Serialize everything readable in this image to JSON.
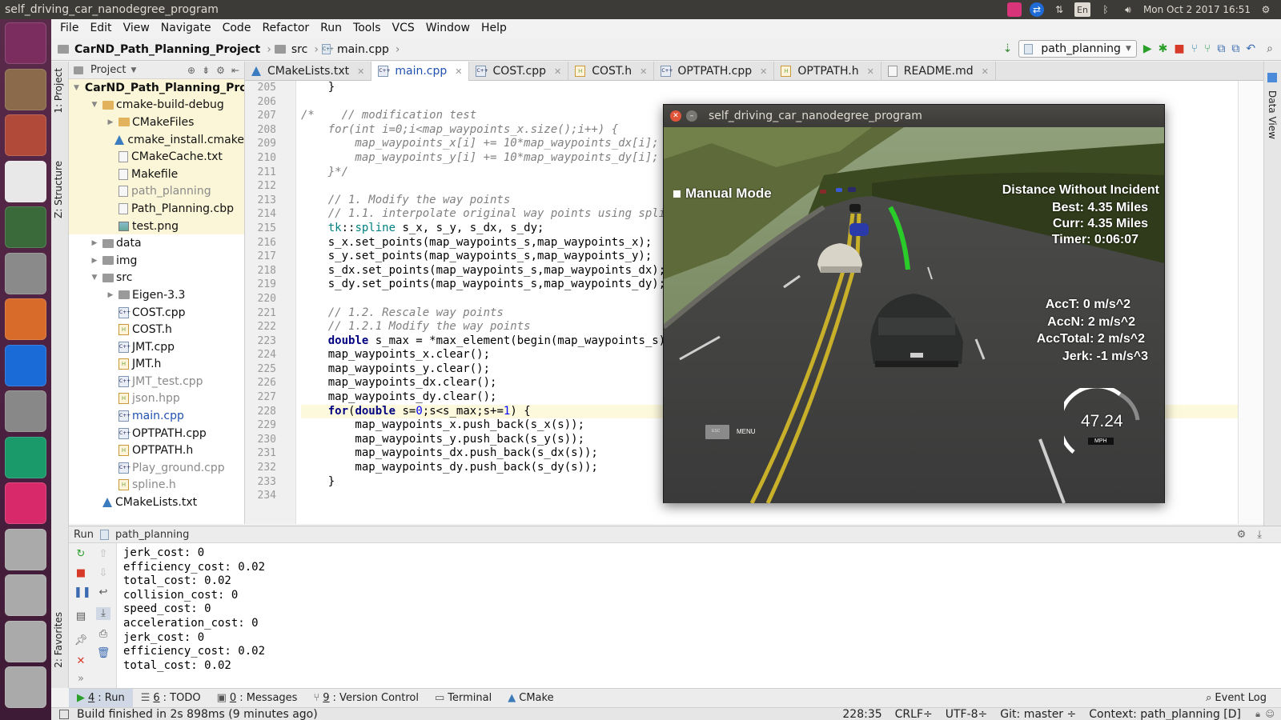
{
  "top_panel": {
    "title": "self_driving_car_nanodegree_program",
    "keyboard_layout": "En",
    "clock": "Mon Oct  2 2017 16:51"
  },
  "launcher": {
    "items": [
      {
        "icon": "ubuntu-dash-icon",
        "color": "#7b2d5f"
      },
      {
        "icon": "files-icon",
        "color": "#8a6a4a"
      },
      {
        "icon": "system-settings-icon",
        "color": "#b24a3a"
      },
      {
        "icon": "chrome-icon",
        "color": "#e8e8e8"
      },
      {
        "icon": "terminal-download-icon",
        "color": "#3a6a3a"
      },
      {
        "icon": "camera-icon",
        "color": "#8a8a8a"
      },
      {
        "icon": "software-center-icon",
        "color": "#d86a2a"
      },
      {
        "icon": "teamviewer-icon",
        "color": "#1a6ad8"
      },
      {
        "icon": "help-icon",
        "color": "#888888"
      },
      {
        "icon": "clion-icon",
        "color": "#1a9a6a"
      },
      {
        "icon": "jetbrains-toolbox-icon",
        "color": "#d82a6a"
      },
      {
        "icon": "drive-icon",
        "color": "#aaaaaa"
      },
      {
        "icon": "drive-icon",
        "color": "#aaaaaa"
      },
      {
        "icon": "drive-icon",
        "color": "#aaaaaa"
      },
      {
        "icon": "drive-icon",
        "color": "#aaaaaa"
      }
    ]
  },
  "menubar": [
    "File",
    "Edit",
    "View",
    "Navigate",
    "Code",
    "Refactor",
    "Run",
    "Tools",
    "VCS",
    "Window",
    "Help"
  ],
  "breadcrumb": {
    "project": "CarND_Path_Planning_Project",
    "folder": "src",
    "file": "main.cpp"
  },
  "run_config": "path_planning",
  "left_strip": {
    "project_tab": "1: Project",
    "structure_tab": "Z: Structure",
    "favorites_tab": "2: Favorites"
  },
  "right_strip": {
    "data_view_tab": "Data View"
  },
  "project_panel": {
    "header": "Project",
    "tree": [
      {
        "label": "CarND_Path_Planning_Pro",
        "indent": 0,
        "arrow": "down",
        "icon": "folder",
        "bold": true,
        "hl": true
      },
      {
        "label": "cmake-build-debug",
        "indent": 1,
        "arrow": "down",
        "icon": "folder-y",
        "hl": true
      },
      {
        "label": "CMakeFiles",
        "indent": 2,
        "arrow": "right",
        "icon": "folder-y",
        "hl": true
      },
      {
        "label": "cmake_install.cmake",
        "indent": 2,
        "arrow": "",
        "icon": "cmake",
        "hl": true
      },
      {
        "label": "CMakeCache.txt",
        "indent": 2,
        "arrow": "",
        "icon": "doc",
        "hl": true
      },
      {
        "label": "Makefile",
        "indent": 2,
        "arrow": "",
        "icon": "doc",
        "hl": true
      },
      {
        "label": "path_planning",
        "indent": 2,
        "arrow": "",
        "icon": "doc",
        "hl": true,
        "muted": true
      },
      {
        "label": "Path_Planning.cbp",
        "indent": 2,
        "arrow": "",
        "icon": "doc",
        "hl": true
      },
      {
        "label": "test.png",
        "indent": 2,
        "arrow": "",
        "icon": "img",
        "hl": true
      },
      {
        "label": "data",
        "indent": 1,
        "arrow": "right",
        "icon": "folder"
      },
      {
        "label": "img",
        "indent": 1,
        "arrow": "right",
        "icon": "folder"
      },
      {
        "label": "src",
        "indent": 1,
        "arrow": "down",
        "icon": "folder"
      },
      {
        "label": "Eigen-3.3",
        "indent": 2,
        "arrow": "right",
        "icon": "folder"
      },
      {
        "label": "COST.cpp",
        "indent": 2,
        "arrow": "",
        "icon": "cpp"
      },
      {
        "label": "COST.h",
        "indent": 2,
        "arrow": "",
        "icon": "h"
      },
      {
        "label": "JMT.cpp",
        "indent": 2,
        "arrow": "",
        "icon": "cpp"
      },
      {
        "label": "JMT.h",
        "indent": 2,
        "arrow": "",
        "icon": "h"
      },
      {
        "label": "JMT_test.cpp",
        "indent": 2,
        "arrow": "",
        "icon": "cpp",
        "muted": true
      },
      {
        "label": "json.hpp",
        "indent": 2,
        "arrow": "",
        "icon": "h",
        "muted": true
      },
      {
        "label": "main.cpp",
        "indent": 2,
        "arrow": "",
        "icon": "cpp",
        "active": true
      },
      {
        "label": "OPTPATH.cpp",
        "indent": 2,
        "arrow": "",
        "icon": "cpp"
      },
      {
        "label": "OPTPATH.h",
        "indent": 2,
        "arrow": "",
        "icon": "h"
      },
      {
        "label": "Play_ground.cpp",
        "indent": 2,
        "arrow": "",
        "icon": "cpp",
        "muted": true
      },
      {
        "label": "spline.h",
        "indent": 2,
        "arrow": "",
        "icon": "h",
        "muted": true
      },
      {
        "label": "CMakeLists.txt",
        "indent": 1,
        "arrow": "",
        "icon": "cmake"
      }
    ]
  },
  "editor_tabs": [
    {
      "label": "CMakeLists.txt",
      "icon": "cmake"
    },
    {
      "label": "main.cpp",
      "icon": "cpp",
      "active": true
    },
    {
      "label": "COST.cpp",
      "icon": "cpp"
    },
    {
      "label": "COST.h",
      "icon": "h"
    },
    {
      "label": "OPTPATH.cpp",
      "icon": "cpp"
    },
    {
      "label": "OPTPATH.h",
      "icon": "h"
    },
    {
      "label": "README.md",
      "icon": "md"
    }
  ],
  "editor": {
    "lines": [
      {
        "n": "205",
        "html": "    }"
      },
      {
        "n": "206",
        "html": ""
      },
      {
        "n": "207",
        "html": "<span class='cm'>/*    // modification test</span>"
      },
      {
        "n": "208",
        "html": "<span class='cm'>    for(int i=0;i&lt;map_waypoints_x.size();i++) {</span>"
      },
      {
        "n": "209",
        "html": "<span class='cm'>        map_waypoints_x[i] += 10*map_waypoints_dx[i];</span>"
      },
      {
        "n": "210",
        "html": "<span class='cm'>        map_waypoints_y[i] += 10*map_waypoints_dy[i];</span>"
      },
      {
        "n": "211",
        "html": "<span class='cm'>    }*/</span>"
      },
      {
        "n": "212",
        "html": ""
      },
      {
        "n": "213",
        "html": "<span class='cm'>    // 1. Modify the way points</span>"
      },
      {
        "n": "214",
        "html": "<span class='cm'>    // 1.1. interpolate original way points using spline</span>"
      },
      {
        "n": "215",
        "html": "    <span class='ns'>tk</span>::<span class='ns'>spline</span> s_x, s_y, s_dx, s_dy;"
      },
      {
        "n": "216",
        "html": "    s_x.set_points(map_waypoints_s,map_waypoints_x);"
      },
      {
        "n": "217",
        "html": "    s_y.set_points(map_waypoints_s,map_waypoints_y);"
      },
      {
        "n": "218",
        "html": "    s_dx.set_points(map_waypoints_s,map_waypoints_dx);"
      },
      {
        "n": "219",
        "html": "    s_dy.set_points(map_waypoints_s,map_waypoints_dy);"
      },
      {
        "n": "220",
        "html": ""
      },
      {
        "n": "221",
        "html": "<span class='cm'>    // 1.2. Rescale way points</span>"
      },
      {
        "n": "222",
        "html": "<span class='cm'>    // 1.2.1 Modify the way points</span>"
      },
      {
        "n": "223",
        "html": "    <span class='kw'>double</span> s_max = *max_element(begin(map_waypoints_s), end(map_waypoints_s));"
      },
      {
        "n": "224",
        "html": "    map_waypoints_x.clear();"
      },
      {
        "n": "225",
        "html": "    map_waypoints_y.clear();"
      },
      {
        "n": "226",
        "html": "    map_waypoints_dx.clear();"
      },
      {
        "n": "227",
        "html": "    map_waypoints_dy.clear();"
      },
      {
        "n": "228",
        "html": "    <span class='kw'>for</span>(<span class='kw'>double</span> s=<span class='num'>0</span>;s&lt;s_max;s+=<span class='num'>1</span>) {",
        "cur": true
      },
      {
        "n": "229",
        "html": "        map_waypoints_x.push_back(s_x(s));"
      },
      {
        "n": "230",
        "html": "        map_waypoints_y.push_back(s_y(s));"
      },
      {
        "n": "231",
        "html": "        map_waypoints_dx.push_back(s_dx(s));"
      },
      {
        "n": "232",
        "html": "        map_waypoints_dy.push_back(s_dy(s));"
      },
      {
        "n": "233",
        "html": "    }"
      },
      {
        "n": "234",
        "html": ""
      }
    ]
  },
  "run_panel": {
    "label": "Run",
    "config": "path_planning",
    "console": [
      "jerk_cost: 0",
      "efficiency_cost: 0.02",
      "total_cost: 0.02",
      "collision_cost: 0",
      "speed_cost: 0",
      "acceleration_cost: 0",
      "jerk_cost: 0",
      "efficiency_cost: 0.02",
      "total_cost: 0.02"
    ]
  },
  "tool_windows": [
    {
      "key": "4",
      "label": ": Run",
      "icon": "run-icon",
      "active": true
    },
    {
      "key": "6",
      "label": ": TODO",
      "icon": "todo-icon"
    },
    {
      "key": "0",
      "label": ": Messages",
      "icon": "messages-icon"
    },
    {
      "key": "9",
      "label": ": Version Control",
      "icon": "vcs-icon"
    },
    {
      "key": "",
      "label": "Terminal",
      "icon": "terminal-icon"
    },
    {
      "key": "",
      "label": "CMake",
      "icon": "cmake-icon"
    }
  ],
  "event_log": "Event Log",
  "status_bar": {
    "message": "Build finished in 2s 898ms (9 minutes ago)",
    "position": "228:35",
    "line_sep": "CRLF÷",
    "encoding": "UTF-8÷",
    "git": "Git: master ÷",
    "context": "Context: path_planning [D]"
  },
  "simulator": {
    "title": "self_driving_car_nanodegree_program",
    "mode": "Manual Mode",
    "distance_title": "Distance Without Incident",
    "best": "Best: 4.35 Miles",
    "curr": "Curr: 4.35 Miles",
    "timer": "Timer: 0:06:07",
    "acc_t": "AccT: 0 m/s^2",
    "acc_n": "AccN: 2 m/s^2",
    "acc_total": "AccTotal: 2 m/s^2",
    "jerk": "Jerk: -1 m/s^3",
    "speed": "47.24",
    "speed_unit": "MPH",
    "esc_label": "ESC",
    "menu_label": "MENU"
  }
}
